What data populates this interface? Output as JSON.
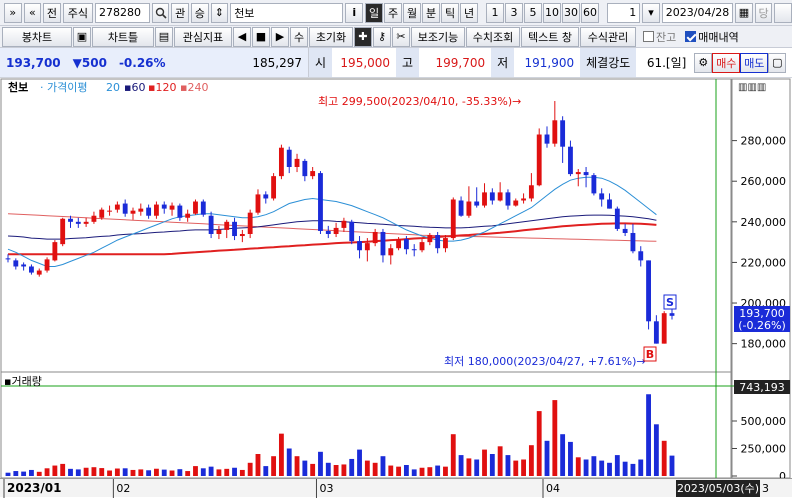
{
  "toolbar1": {
    "nav_prev": "»",
    "nav_up": "«",
    "prev_btn": "전",
    "market_type": "주식",
    "code": "278280",
    "search_icon": "search-icon",
    "watch_btn": "관",
    "updown_btn": "승",
    "stock_name": "천보",
    "info_btn": "i",
    "periods": [
      "일",
      "주",
      "월",
      "분",
      "틱",
      "년"
    ],
    "active_period": "일",
    "minutes": [
      "1",
      "3",
      "5",
      "10",
      "30",
      "60"
    ],
    "count": "1",
    "date": "2023/04/28",
    "pull_btn": "당"
  },
  "toolbar2": {
    "candle_btn": "봉차트",
    "chart_tool_btn": "차트틀",
    "indicator_btn": "관심지표",
    "num_btn": "수",
    "reset_btn": "초기화",
    "aux_btn": "보조기능",
    "numeric_btn": "수치조회",
    "text_btn": "텍스트 창",
    "formula_btn": "수식관리",
    "balance_label": "잔고",
    "trades_label": "매매내역",
    "balance_checked": false,
    "trades_checked": true
  },
  "pricebar": {
    "price": "193,700",
    "change": "▼500",
    "change_pct": "-0.26%",
    "volume": "185,297",
    "open_label": "시",
    "open": "195,000",
    "high_label": "고",
    "high": "199,700",
    "low_label": "저",
    "low": "191,900",
    "strength_label": "체결강도",
    "strength": "61.[일]",
    "buy_btn": "매수",
    "sell_btn": "매도"
  },
  "legend": {
    "name": "천보",
    "envelope": "가격이평",
    "ma20": "20",
    "ma60": "60",
    "ma120": "120",
    "ma240": "240"
  },
  "annotations": {
    "high_note": "최고 299,500(2023/04/10, -35.33%)→",
    "low_note": "최저 180,000(2023/04/27, +7.61%)→",
    "sell_marker": "S",
    "buy_marker": "B",
    "price_tag_line1": "193,700",
    "price_tag_line2": "(-0.26%)",
    "volume_tag": "743,193",
    "volume_title": "거래량",
    "cursor_date": "2023/05/03(수)",
    "cursor_suffix": "3"
  },
  "colors": {
    "up": "#e01010",
    "down": "#1a2bd8",
    "ma20": "#2b8fd6",
    "ma60": "#1a1a7a",
    "ma120": "#e02020",
    "ma240": "#e06060"
  },
  "chart_data": {
    "type": "candlestick",
    "price_axis": {
      "ticks": [
        "280,000",
        "260,000",
        "240,000",
        "220,000",
        "200,000",
        "180,000"
      ],
      "tick_values": [
        280000,
        260000,
        240000,
        220000,
        200000,
        180000
      ]
    },
    "volume_axis": {
      "ticks": [
        "500,000",
        "250,000",
        "0"
      ],
      "tick_values": [
        500000,
        250000,
        0
      ]
    },
    "x_labels": [
      {
        "label": "2023/01",
        "index": 0
      },
      {
        "label": "02",
        "index": 14
      },
      {
        "label": "03",
        "index": 40
      },
      {
        "label": "04",
        "index": 69
      }
    ],
    "candles": [
      {
        "o": 222000,
        "c": 221500,
        "h": 224000,
        "l": 220000,
        "v": 30000
      },
      {
        "o": 221000,
        "c": 218000,
        "h": 222000,
        "l": 216500,
        "v": 45000
      },
      {
        "o": 219000,
        "c": 218000,
        "h": 220000,
        "l": 216000,
        "v": 40000
      },
      {
        "o": 218000,
        "c": 215000,
        "h": 219000,
        "l": 214000,
        "v": 55000
      },
      {
        "o": 214000,
        "c": 216000,
        "h": 217000,
        "l": 213000,
        "v": 38000
      },
      {
        "o": 216000,
        "c": 221500,
        "h": 222500,
        "l": 215000,
        "v": 70000
      },
      {
        "o": 221000,
        "c": 230000,
        "h": 231000,
        "l": 220500,
        "v": 95000
      },
      {
        "o": 229000,
        "c": 241500,
        "h": 242000,
        "l": 228000,
        "v": 110000
      },
      {
        "o": 241500,
        "c": 240000,
        "h": 243000,
        "l": 237000,
        "v": 65000
      },
      {
        "o": 240000,
        "c": 239000,
        "h": 242000,
        "l": 237000,
        "v": 60000
      },
      {
        "o": 239000,
        "c": 240000,
        "h": 242000,
        "l": 237500,
        "v": 75000
      },
      {
        "o": 240000,
        "c": 243000,
        "h": 245000,
        "l": 239000,
        "v": 80000
      },
      {
        "o": 242000,
        "c": 246000,
        "h": 247000,
        "l": 241000,
        "v": 72000
      },
      {
        "o": 245000,
        "c": 245500,
        "h": 248000,
        "l": 243000,
        "v": 50000
      },
      {
        "o": 246000,
        "c": 248500,
        "h": 250000,
        "l": 244500,
        "v": 68000
      },
      {
        "o": 249000,
        "c": 244000,
        "h": 251000,
        "l": 242500,
        "v": 70000
      },
      {
        "o": 244000,
        "c": 245500,
        "h": 247000,
        "l": 241000,
        "v": 55000
      },
      {
        "o": 245000,
        "c": 246500,
        "h": 249000,
        "l": 243000,
        "v": 60000
      },
      {
        "o": 247000,
        "c": 243000,
        "h": 248500,
        "l": 241500,
        "v": 52000
      },
      {
        "o": 243000,
        "c": 248500,
        "h": 250000,
        "l": 241500,
        "v": 66000
      },
      {
        "o": 248500,
        "c": 246500,
        "h": 250000,
        "l": 244000,
        "v": 58000
      },
      {
        "o": 246000,
        "c": 248000,
        "h": 249500,
        "l": 243000,
        "v": 50000
      },
      {
        "o": 248000,
        "c": 242000,
        "h": 249000,
        "l": 240500,
        "v": 62000
      },
      {
        "o": 242000,
        "c": 244000,
        "h": 246000,
        "l": 240000,
        "v": 45000
      },
      {
        "o": 244000,
        "c": 250000,
        "h": 251000,
        "l": 243500,
        "v": 90000
      },
      {
        "o": 250000,
        "c": 243500,
        "h": 251000,
        "l": 242500,
        "v": 70000
      },
      {
        "o": 243000,
        "c": 234000,
        "h": 245000,
        "l": 232000,
        "v": 85000
      },
      {
        "o": 234000,
        "c": 236000,
        "h": 238000,
        "l": 231500,
        "v": 60000
      },
      {
        "o": 236000,
        "c": 240000,
        "h": 241000,
        "l": 232000,
        "v": 65000
      },
      {
        "o": 240000,
        "c": 233000,
        "h": 242000,
        "l": 231000,
        "v": 75000
      },
      {
        "o": 233000,
        "c": 234000,
        "h": 236000,
        "l": 230000,
        "v": 55000
      },
      {
        "o": 234000,
        "c": 244500,
        "h": 246000,
        "l": 232000,
        "v": 120000
      },
      {
        "o": 244500,
        "c": 253500,
        "h": 256000,
        "l": 243500,
        "v": 200000
      },
      {
        "o": 253500,
        "c": 251500,
        "h": 255000,
        "l": 249000,
        "v": 90000
      },
      {
        "o": 251500,
        "c": 262500,
        "h": 264000,
        "l": 250500,
        "v": 180000
      },
      {
        "o": 262500,
        "c": 276500,
        "h": 278000,
        "l": 261000,
        "v": 385000
      },
      {
        "o": 275500,
        "c": 267000,
        "h": 277000,
        "l": 264000,
        "v": 250000
      },
      {
        "o": 267000,
        "c": 271000,
        "h": 273500,
        "l": 264500,
        "v": 180000
      },
      {
        "o": 270000,
        "c": 262500,
        "h": 271000,
        "l": 260000,
        "v": 140000
      },
      {
        "o": 262500,
        "c": 265000,
        "h": 267000,
        "l": 261000,
        "v": 110000
      },
      {
        "o": 264000,
        "c": 235500,
        "h": 265000,
        "l": 234000,
        "v": 220000
      },
      {
        "o": 235500,
        "c": 234000,
        "h": 238000,
        "l": 232000,
        "v": 120000
      },
      {
        "o": 234000,
        "c": 237000,
        "h": 239500,
        "l": 232500,
        "v": 100000
      },
      {
        "o": 237000,
        "c": 240500,
        "h": 242000,
        "l": 235000,
        "v": 105000
      },
      {
        "o": 240000,
        "c": 230500,
        "h": 241000,
        "l": 229000,
        "v": 155000
      },
      {
        "o": 230500,
        "c": 226000,
        "h": 233000,
        "l": 222000,
        "v": 240000
      },
      {
        "o": 226000,
        "c": 229500,
        "h": 232000,
        "l": 220500,
        "v": 140000
      },
      {
        "o": 229500,
        "c": 235000,
        "h": 236500,
        "l": 228000,
        "v": 120000
      },
      {
        "o": 235000,
        "c": 223500,
        "h": 236500,
        "l": 220000,
        "v": 180000
      },
      {
        "o": 223500,
        "c": 227000,
        "h": 229000,
        "l": 219000,
        "v": 95000
      },
      {
        "o": 227000,
        "c": 231500,
        "h": 232500,
        "l": 226000,
        "v": 85000
      },
      {
        "o": 231500,
        "c": 226500,
        "h": 233000,
        "l": 224000,
        "v": 100000
      },
      {
        "o": 226500,
        "c": 226000,
        "h": 229000,
        "l": 223000,
        "v": 60000
      },
      {
        "o": 226000,
        "c": 230000,
        "h": 231500,
        "l": 225000,
        "v": 75000
      },
      {
        "o": 230000,
        "c": 233500,
        "h": 234500,
        "l": 228500,
        "v": 80000
      },
      {
        "o": 233500,
        "c": 227000,
        "h": 235000,
        "l": 224500,
        "v": 95000
      },
      {
        "o": 227000,
        "c": 232000,
        "h": 233500,
        "l": 225000,
        "v": 85000
      },
      {
        "o": 232000,
        "c": 251000,
        "h": 252000,
        "l": 231000,
        "v": 380000
      },
      {
        "o": 250500,
        "c": 243000,
        "h": 252500,
        "l": 242500,
        "v": 190000
      },
      {
        "o": 243000,
        "c": 250000,
        "h": 257500,
        "l": 242000,
        "v": 160000
      },
      {
        "o": 250000,
        "c": 248000,
        "h": 257000,
        "l": 247000,
        "v": 150000
      },
      {
        "o": 248000,
        "c": 254500,
        "h": 259000,
        "l": 247000,
        "v": 240000
      },
      {
        "o": 254500,
        "c": 250500,
        "h": 256500,
        "l": 248500,
        "v": 200000
      },
      {
        "o": 250500,
        "c": 254500,
        "h": 259500,
        "l": 250000,
        "v": 270000
      },
      {
        "o": 254500,
        "c": 248000,
        "h": 256000,
        "l": 246000,
        "v": 190000
      },
      {
        "o": 248000,
        "c": 250500,
        "h": 251500,
        "l": 247500,
        "v": 140000
      },
      {
        "o": 250500,
        "c": 251500,
        "h": 254000,
        "l": 249000,
        "v": 150000
      },
      {
        "o": 251500,
        "c": 258000,
        "h": 264000,
        "l": 250000,
        "v": 280000
      },
      {
        "o": 258000,
        "c": 283000,
        "h": 286000,
        "l": 257500,
        "v": 590000
      },
      {
        "o": 283000,
        "c": 278500,
        "h": 287000,
        "l": 276500,
        "v": 320000
      },
      {
        "o": 278500,
        "c": 290000,
        "h": 299500,
        "l": 277000,
        "v": 690000
      },
      {
        "o": 290000,
        "c": 277000,
        "h": 292000,
        "l": 269000,
        "v": 380000
      },
      {
        "o": 277000,
        "c": 263500,
        "h": 280000,
        "l": 262500,
        "v": 310000
      },
      {
        "o": 263500,
        "c": 264500,
        "h": 266000,
        "l": 257500,
        "v": 170000
      },
      {
        "o": 264500,
        "c": 263000,
        "h": 267000,
        "l": 257000,
        "v": 150000
      },
      {
        "o": 263000,
        "c": 254000,
        "h": 264000,
        "l": 253000,
        "v": 180000
      },
      {
        "o": 254000,
        "c": 251000,
        "h": 256500,
        "l": 247500,
        "v": 140000
      },
      {
        "o": 251000,
        "c": 246500,
        "h": 254000,
        "l": 246500,
        "v": 120000
      },
      {
        "o": 246500,
        "c": 236500,
        "h": 247500,
        "l": 235500,
        "v": 190000
      },
      {
        "o": 236500,
        "c": 234500,
        "h": 239000,
        "l": 233000,
        "v": 130000
      },
      {
        "o": 234500,
        "c": 225500,
        "h": 239000,
        "l": 224500,
        "v": 110000
      },
      {
        "o": 225500,
        "c": 221000,
        "h": 228000,
        "l": 218000,
        "v": 150000
      },
      {
        "o": 221000,
        "c": 191000,
        "h": 221000,
        "l": 187000,
        "v": 743193
      },
      {
        "o": 191000,
        "c": 180000,
        "h": 194000,
        "l": 180000,
        "v": 470000
      },
      {
        "o": 180000,
        "c": 195000,
        "h": 196000,
        "l": 180000,
        "v": 320000
      },
      {
        "o": 195000,
        "c": 193700,
        "h": 199700,
        "l": 191900,
        "v": 185297
      }
    ],
    "ma20": [
      226500,
      225000,
      223000,
      221000,
      219500,
      218000,
      218000,
      219000,
      220500,
      222000,
      223500,
      225000,
      227000,
      229000,
      231000,
      232500,
      234000,
      235500,
      237000,
      238500,
      240000,
      241500,
      242500,
      243000,
      243500,
      244000,
      244000,
      243500,
      243000,
      242500,
      242000,
      242000,
      242500,
      243500,
      245000,
      247000,
      249000,
      250000,
      251000,
      251500,
      251000,
      250500,
      250000,
      249000,
      248000,
      246500,
      245000,
      243500,
      242000,
      240000,
      238000,
      236000,
      234500,
      233000,
      232000,
      231000,
      230500,
      230500,
      231000,
      232000,
      233500,
      235000,
      237000,
      239000,
      241000,
      243000,
      245000,
      247000,
      250000,
      253000,
      256000,
      258500,
      260500,
      261500,
      262000,
      262000,
      261500,
      260000,
      258000,
      255500,
      252500,
      249500,
      246500,
      243500
    ],
    "ma60": [
      233000,
      232800,
      232500,
      232000,
      231800,
      231500,
      231500,
      231500,
      231800,
      232000,
      232200,
      232500,
      232800,
      233000,
      233500,
      233800,
      234000,
      234200,
      234500,
      234800,
      235000,
      235300,
      235500,
      235800,
      236000,
      236000,
      236000,
      236200,
      236500,
      236800,
      237000,
      237200,
      237500,
      238000,
      238500,
      239000,
      239500,
      240000,
      240300,
      240500,
      240500,
      240500,
      240200,
      240000,
      239800,
      239500,
      239200,
      239000,
      238800,
      238500,
      238200,
      238000,
      237800,
      237500,
      237300,
      237200,
      237000,
      237000,
      237000,
      237200,
      237500,
      237800,
      238000,
      238500,
      239000,
      239500,
      240000,
      240500,
      241000,
      241500,
      242000,
      242500,
      242800,
      243000,
      243200,
      243300,
      243300,
      243200,
      243000,
      242800,
      242500,
      242000,
      241500,
      240800
    ],
    "ma120": [
      224000,
      224000,
      224000,
      224000,
      224000,
      224000,
      224000,
      224000,
      224000,
      224000,
      224000,
      224000,
      224000,
      224000,
      224000,
      224000,
      224000,
      224000,
      224000,
      224000,
      224000,
      224200,
      224500,
      224800,
      225000,
      225300,
      225500,
      225800,
      226000,
      226200,
      226500,
      226800,
      227000,
      227300,
      227500,
      227800,
      228000,
      228300,
      228500,
      228800,
      229000,
      229200,
      229500,
      229700,
      229800,
      230000,
      230200,
      230500,
      230700,
      231000,
      231200,
      231500,
      231800,
      232000,
      232300,
      232500,
      232800,
      233000,
      233300,
      233500,
      233800,
      234000,
      234300,
      234600,
      235000,
      235400,
      235800,
      236200,
      236600,
      237000,
      237400,
      237800,
      238100,
      238400,
      238600,
      238800,
      239000,
      239100,
      239200,
      239200,
      239100,
      239000,
      238800,
      238500
    ],
    "ma240": [
      244000,
      243800,
      243600,
      243400,
      243200,
      243000,
      242800,
      242600,
      242400,
      242200,
      242000,
      241800,
      241600,
      241400,
      241200,
      241000,
      240800,
      240600,
      240400,
      240200,
      240000,
      239800,
      239600,
      239400,
      239200,
      239000,
      238800,
      238600,
      238400,
      238200,
      238000,
      237800,
      237600,
      237400,
      237200,
      237000,
      236800,
      236600,
      236400,
      236200,
      236000,
      235800,
      235600,
      235400,
      235200,
      235000,
      234800,
      234600,
      234400,
      234200,
      234000,
      233800,
      233600,
      233400,
      233300,
      233200,
      233100,
      233000,
      232900,
      232800,
      232700,
      232600,
      232500,
      232400,
      232300,
      232200,
      232100,
      232000,
      231900,
      231800,
      231700,
      231600,
      231500,
      231400,
      231300,
      231200,
      231100,
      231000,
      230900,
      230800,
      230700,
      230600,
      230500,
      230400
    ],
    "price_range": [
      168000,
      300000
    ],
    "volume_range": [
      0,
      800000
    ]
  }
}
